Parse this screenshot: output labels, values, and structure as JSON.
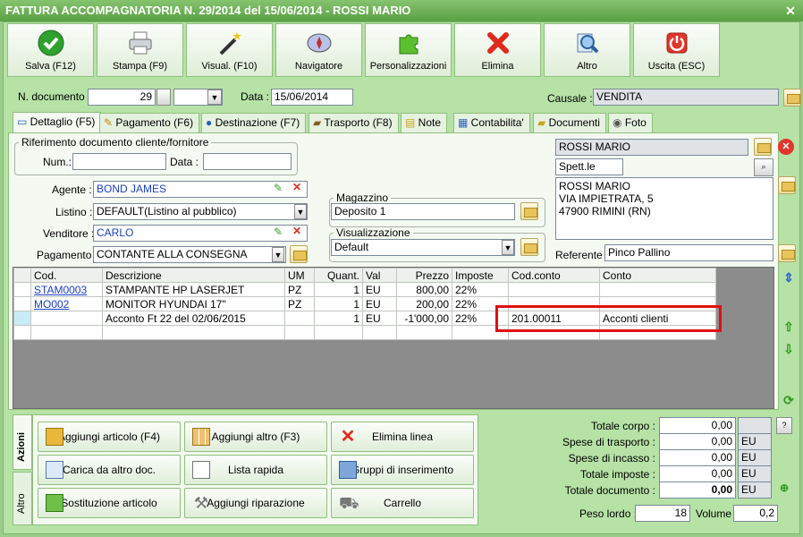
{
  "window": {
    "title": "FATTURA ACCOMPAGNATORIA N. 29/2014 del 15/06/2014 - ROSSI MARIO"
  },
  "toolbar": [
    {
      "label": "Salva (F12)",
      "icon": "check-icon"
    },
    {
      "label": "Stampa (F9)",
      "icon": "printer-icon"
    },
    {
      "label": "Visual. (F10)",
      "icon": "magic-wand-icon"
    },
    {
      "label": "Navigatore",
      "icon": "compass-icon"
    },
    {
      "label": "Personalizzazioni",
      "icon": "puzzle-icon"
    },
    {
      "label": "Elimina",
      "icon": "delete-x-icon"
    },
    {
      "label": "Altro",
      "icon": "magnifier-icon"
    },
    {
      "label": "Uscita (ESC)",
      "icon": "power-icon"
    }
  ],
  "header": {
    "ndoc_label": "N. documento :",
    "ndoc_value": "29",
    "data_label": "Data :",
    "data_value": "15/06/2014",
    "causale_label": "Causale :",
    "causale_value": "VENDITA"
  },
  "tabs": [
    "Dettaglio (F5)",
    "Pagamento (F6)",
    "Destinazione (F7)",
    "Trasporto (F8)",
    "Note",
    "Contabilita'",
    "Documenti",
    "Foto"
  ],
  "riferimento": {
    "legend": "Riferimento documento cliente/fornitore",
    "num_label": "Num.:",
    "data_label": "Data :"
  },
  "fields": {
    "agente_label": "Agente :",
    "agente_value": "BOND JAMES",
    "listino_label": "Listino :",
    "listino_value": "DEFAULT(Listino al pubblico)",
    "venditore_label": "Venditore :",
    "venditore_value": "CARLO",
    "pagamento_label": "Pagamento :",
    "pagamento_value": "CONTANTE ALLA CONSEGNA",
    "magazzino_legend": "Magazzino",
    "magazzino_value": "Deposito 1",
    "visual_legend": "Visualizzazione",
    "visual_value": "Default"
  },
  "cliente": {
    "name": "ROSSI MARIO",
    "spett": "Spett.le",
    "address": [
      "ROSSI MARIO",
      "VIA IMPIETRATA, 5",
      "47900 RIMINI (RN)"
    ],
    "referente_label": "Referente",
    "referente_value": "Pinco Pallino"
  },
  "grid": {
    "columns": [
      "Cod.",
      "Descrizione",
      "UM",
      "Quant.",
      "Val",
      "Prezzo",
      "Imposte",
      "Cod.conto",
      "Conto"
    ],
    "rows": [
      [
        "STAM0003",
        "STAMPANTE HP LASERJET",
        "PZ",
        "1",
        "EU",
        "800,00",
        "22%",
        "",
        ""
      ],
      [
        "MO002",
        "MONITOR HYUNDAI 17\"",
        "PZ",
        "1",
        "EU",
        "200,00",
        "22%",
        "",
        ""
      ],
      [
        "",
        "Acconto Ft 22 del 02/06/2015",
        "",
        "1",
        "EU",
        "-1'000,00",
        "22%",
        "201.00011",
        "Acconti clienti"
      ]
    ]
  },
  "side_tabs": {
    "azioni": "Azioni",
    "altro": "Altro"
  },
  "actions": [
    {
      "label": "Aggiungi articolo (F4)",
      "icon": "add-box-icon"
    },
    {
      "label": "Aggiungi altro (F3)",
      "icon": "add-grid-icon"
    },
    {
      "label": "Elimina linea",
      "icon": "delete-x-icon"
    },
    {
      "label": "Carica da altro doc.",
      "icon": "load-doc-icon"
    },
    {
      "label": "Lista rapida",
      "icon": "quick-list-icon"
    },
    {
      "label": "Gruppi di inserimento",
      "icon": "groups-icon"
    },
    {
      "label": "Sostituzione articolo",
      "icon": "replace-icon"
    },
    {
      "label": "Aggiungi riparazione",
      "icon": "wrench-icon"
    },
    {
      "label": "Carrello",
      "icon": "cart-icon"
    }
  ],
  "totals": {
    "corpo_label": "Totale corpo :",
    "corpo_value": "0,00",
    "help": "?",
    "trasporto_label": "Spese di trasporto :",
    "trasporto_value": "0,00",
    "trasporto_cur": "EU",
    "incasso_label": "Spese di incasso :",
    "incasso_value": "0,00",
    "incasso_cur": "EU",
    "imposte_label": "Totale imposte :",
    "imposte_value": "0,00",
    "imposte_cur": "EU",
    "documento_label": "Totale documento :",
    "documento_value": "0,00",
    "documento_cur": "EU",
    "peso_label": "Peso lordo :",
    "peso_value": "18",
    "volume_label": "Volume :",
    "volume_value": "0,2"
  }
}
